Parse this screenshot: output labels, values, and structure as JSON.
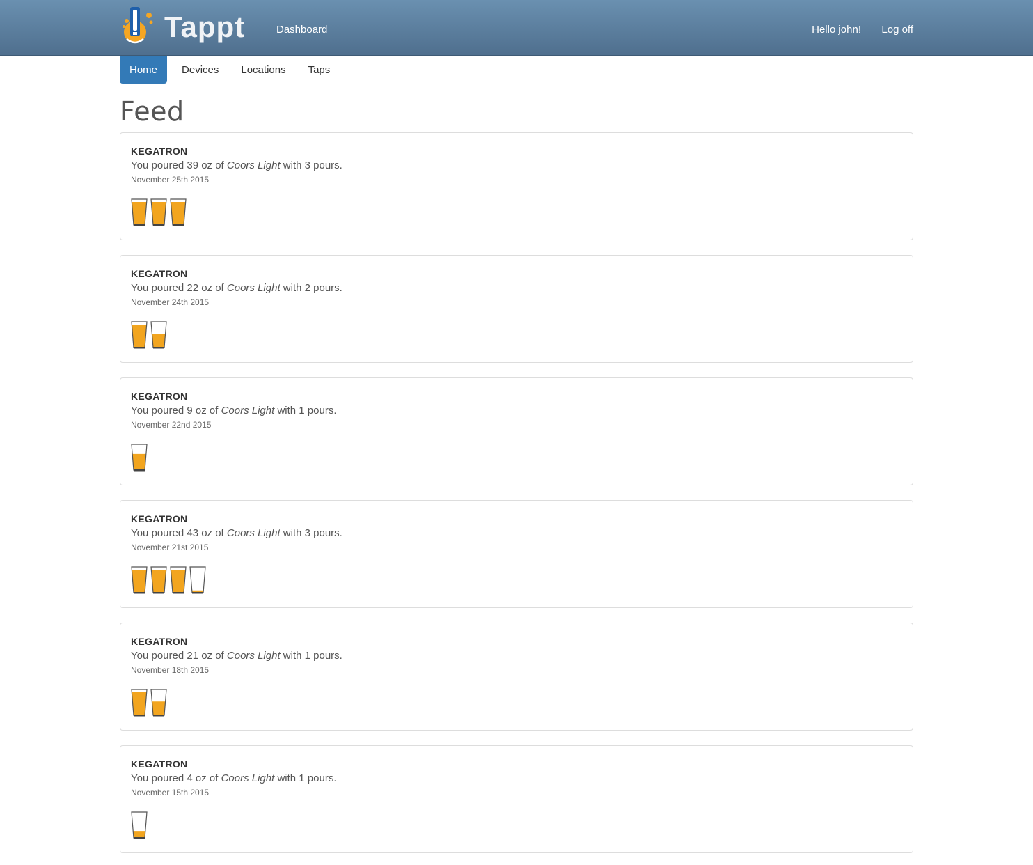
{
  "app": {
    "brand": "Tappt",
    "nav": {
      "dashboard": "Dashboard",
      "greeting": "Hello john!",
      "logoff": "Log off"
    }
  },
  "subnav": {
    "items": [
      {
        "label": "Home",
        "active": true
      },
      {
        "label": "Devices",
        "active": false
      },
      {
        "label": "Locations",
        "active": false
      },
      {
        "label": "Taps",
        "active": false
      }
    ]
  },
  "page": {
    "title": "Feed"
  },
  "feed": [
    {
      "device": "KEGATRON",
      "prefix": "You poured 39 oz of",
      "beer": "Coors Light",
      "suffix": "with 3 pours.",
      "date": "November 25th 2015",
      "glass_fill": [
        1,
        1,
        1
      ]
    },
    {
      "device": "KEGATRON",
      "prefix": "You poured 22 oz of",
      "beer": "Coors Light",
      "suffix": "with 2 pours.",
      "date": "November 24th 2015",
      "glass_fill": [
        1,
        0.6
      ]
    },
    {
      "device": "KEGATRON",
      "prefix": "You poured 9 oz of",
      "beer": "Coors Light",
      "suffix": "with 1 pours.",
      "date": "November 22nd 2015",
      "glass_fill": [
        0.7
      ]
    },
    {
      "device": "KEGATRON",
      "prefix": "You poured 43 oz of",
      "beer": "Coors Light",
      "suffix": "with 3 pours.",
      "date": "November 21st 2015",
      "glass_fill": [
        1,
        1,
        1,
        0.1
      ]
    },
    {
      "device": "KEGATRON",
      "prefix": "You poured 21 oz of",
      "beer": "Coors Light",
      "suffix": "with 1 pours.",
      "date": "November 18th 2015",
      "glass_fill": [
        1,
        0.6
      ]
    },
    {
      "device": "KEGATRON",
      "prefix": "You poured 4 oz of",
      "beer": "Coors Light",
      "suffix": "with 1 pours.",
      "date": "November 15th 2015",
      "glass_fill": [
        0.3
      ]
    }
  ],
  "colors": {
    "navbar": "#5a7d9c",
    "active_tab": "#337ab7",
    "beer": "#f2a51f",
    "logo_blue": "#1f5faa",
    "logo_orange": "#f5a623"
  }
}
